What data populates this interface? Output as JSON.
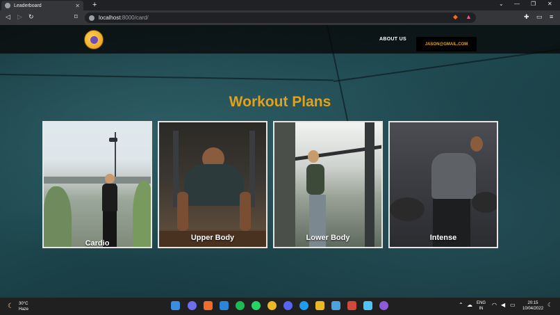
{
  "browser": {
    "tab_title": "Leaderboard",
    "url_host": "localhost",
    "url_rest": ":8000/card/"
  },
  "site": {
    "about_label": "ABOUT US",
    "email_label": "JASON@GMAIL.COM",
    "heading": "Workout Plans",
    "cards": [
      {
        "label": "Cardio"
      },
      {
        "label": "Upper Body"
      },
      {
        "label": "Lower Body"
      },
      {
        "label": "Intense"
      }
    ]
  },
  "taskbar": {
    "temperature": "30°C",
    "condition": "Haze",
    "language": "ENG",
    "region": "IN",
    "time": "20:15",
    "date": "10/04/2022"
  },
  "colors": {
    "accent": "#e0a21e",
    "header_bg": "#0a0a0a"
  }
}
